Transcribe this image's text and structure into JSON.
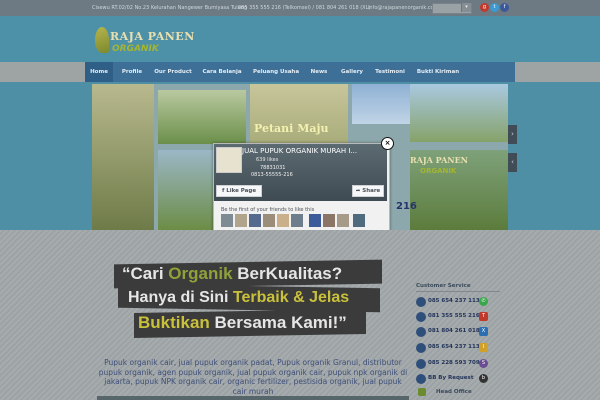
{
  "topbar": {
    "address": "Cisewu RT.02/02 No.23 Kelurahan Nangewer Bumiyasa Tulang",
    "phone": "085 355 555 216 (Telkomsel) / 081 804 261 018 (XL)",
    "email": "info@rajapanenorganik.com"
  },
  "logo": {
    "line1": "RAJA PANEN",
    "line2": "ORGANIK"
  },
  "nav": {
    "items": [
      {
        "label": "Home"
      },
      {
        "label": "Profile"
      },
      {
        "label": "Our Product"
      },
      {
        "label": "Cara Belanja"
      },
      {
        "label": "Peluang Usaha"
      },
      {
        "label": "News"
      },
      {
        "label": "Gallery"
      },
      {
        "label": "Testimoni"
      },
      {
        "label": "Bukti Kiriman"
      }
    ]
  },
  "slider": {
    "caption": "Petani Maju",
    "sign_line1": "RAJA PANEN",
    "sign_line2": "ORGANIK",
    "sign_number": "216"
  },
  "popup": {
    "page_title": "JUAL PUPUK ORGANIK MURAH I...",
    "likes": "639 likes",
    "phone_1": "78831031",
    "phone_2": "0813-55555-216",
    "like_button": "Like Page",
    "share_button": "Share",
    "friends_text": "Be the first of your friends to like this"
  },
  "banner": {
    "line1_a": "“Cari ",
    "line1_b": "Organik",
    "line1_c": " BerKualitas?",
    "line2_a": "Hanya di Sini  ",
    "line2_b": "Terbaik & Jelas",
    "line3_a": "Buktikan",
    "line3_b": " Bersama  Kami!”"
  },
  "description": "Pupuk organik cair, jual pupuk organik padat, Pupuk organik Granul, distributor pupuk organik, agen pupuk organik, jual pupuk organik cair, pupuk npk organik di jakarta, pupuk NPK organik cair, organic fertilizer, pestisida organik, jual pupuk cair murah",
  "sidebar": {
    "title": "Customer Service",
    "rows": [
      {
        "number": "085 654 237 113"
      },
      {
        "number": "081 355 555 216"
      },
      {
        "number": "081 804 261 018"
      },
      {
        "number": "085 654 237 113"
      },
      {
        "number": "085 228 593 709"
      },
      {
        "number": "BB By Request"
      }
    ],
    "head_office": "Head Office"
  },
  "colors": {
    "header": "#4d91a9",
    "nav": "#3e6f97",
    "accent_green": "#8fa23a",
    "accent_yellow": "#c9c13b"
  }
}
